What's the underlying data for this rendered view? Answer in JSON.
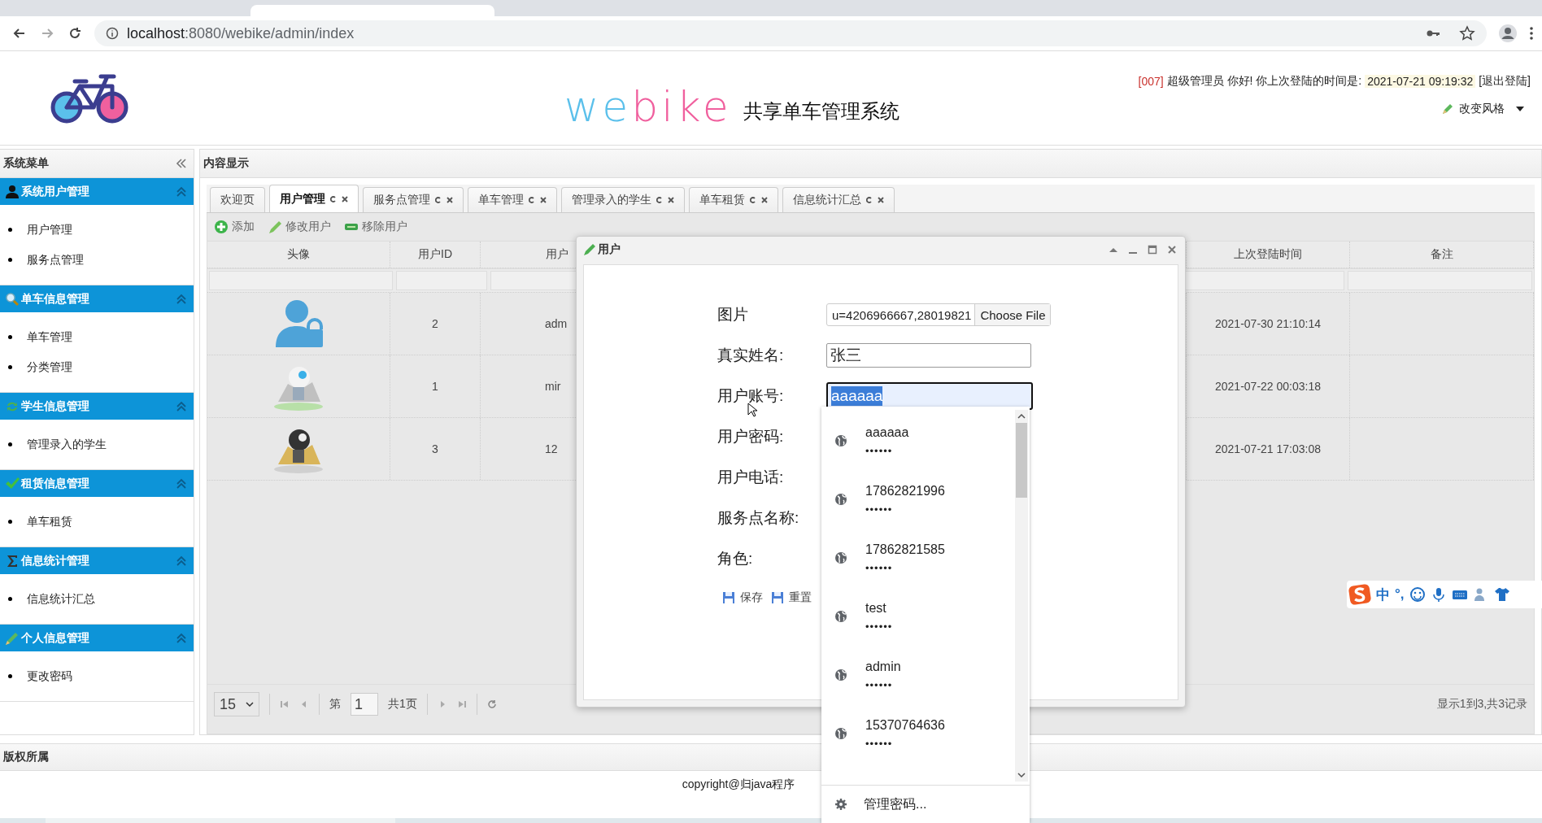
{
  "browser": {
    "host": "localhost",
    "path": ":8080/webike/admin/index"
  },
  "header": {
    "logo_parts": [
      {
        "text": "we",
        "color": "#5bc0eb"
      },
      {
        "text": "bike",
        "color": "#f0609e"
      }
    ],
    "subtitle": "共享单车管理系统",
    "user_code": "[007]",
    "greeting": "超级管理员 你好! 你上次登陆的时间是:",
    "last_login": "2021-07-21 09:19:32",
    "logout": "[退出登陆]",
    "style_menu": "改变风格"
  },
  "sidebar": {
    "title": "系统菜单",
    "sections": [
      {
        "title": "系统用户管理",
        "kind": "user",
        "expanded": true,
        "items": [
          "用户管理",
          "服务点管理"
        ]
      },
      {
        "title": "单车信息管理",
        "kind": "search",
        "expanded": true,
        "items": [
          "单车管理",
          "分类管理"
        ]
      },
      {
        "title": "学生信息管理",
        "kind": "refresh",
        "expanded": true,
        "items": [
          "管理录入的学生"
        ]
      },
      {
        "title": "租赁信息管理",
        "kind": "check",
        "expanded": true,
        "items": [
          "单车租赁"
        ]
      },
      {
        "title": "信息统计管理",
        "kind": "sigma",
        "expanded": true,
        "items": [
          "信息统计汇总"
        ]
      },
      {
        "title": "个人信息管理",
        "kind": "pencil",
        "expanded": true,
        "items": [
          "更改密码"
        ]
      }
    ]
  },
  "content": {
    "title": "内容显示",
    "tabs": [
      {
        "label": "欢迎页",
        "selected": false,
        "closable": false
      },
      {
        "label": "用户管理",
        "selected": true,
        "closable": true
      },
      {
        "label": "服务点管理",
        "selected": false,
        "closable": true
      },
      {
        "label": "单车管理",
        "selected": false,
        "closable": true
      },
      {
        "label": "管理录入的学生",
        "selected": false,
        "closable": true
      },
      {
        "label": "单车租赁",
        "selected": false,
        "closable": true
      },
      {
        "label": "信息统计汇总",
        "selected": false,
        "closable": true
      }
    ],
    "toolbar": [
      {
        "label": "添加",
        "kind": "add"
      },
      {
        "label": "修改用户",
        "kind": "edit"
      },
      {
        "label": "移除用户",
        "kind": "remove"
      }
    ],
    "columns": [
      "头像",
      "用户ID",
      "用户",
      "上次登陆时间",
      "备注"
    ],
    "rows": [
      {
        "kind": "icon",
        "id": "2",
        "account": "adm",
        "last_login": "2021-07-30 21:10:14"
      },
      {
        "kind": "picture",
        "id": "1",
        "account": "mir",
        "last_login": "2021-07-22 00:03:18"
      },
      {
        "kind": "picture",
        "id": "3",
        "account": "12",
        "last_login": "2021-07-21 17:03:08"
      }
    ],
    "pager": {
      "page_size": "15",
      "page_label": "第",
      "page": "1",
      "total_pages": "共1页",
      "summary": "显示1到3,共3记录"
    }
  },
  "dialog": {
    "title": "用户",
    "fields": [
      {
        "label": "图片",
        "kind": "file",
        "value": "u=4206966667,28019821",
        "button": "Choose File"
      },
      {
        "label": "真实姓名:",
        "kind": "text",
        "value": "张三"
      },
      {
        "label": "用户账号:",
        "kind": "selected",
        "value": "aaaaaa"
      },
      {
        "label": "用户密码:",
        "kind": "hidden"
      },
      {
        "label": "用户电话:",
        "kind": "hidden"
      },
      {
        "label": "服务点名称:",
        "kind": "hidden"
      },
      {
        "label": "角色:",
        "kind": "hidden"
      }
    ],
    "buttons": [
      "保存",
      "重置"
    ]
  },
  "autocomplete": {
    "entries": [
      {
        "name": "aaaaaa",
        "mask": "••••••"
      },
      {
        "name": "17862821996",
        "mask": "••••••"
      },
      {
        "name": "17862821585",
        "mask": "••••••"
      },
      {
        "name": "test",
        "mask": "••••••"
      },
      {
        "name": "admin",
        "mask": "••••••"
      },
      {
        "name": "15370764636",
        "mask": "••••••"
      }
    ],
    "manage": "管理密码..."
  },
  "footer": {
    "title": "版权所属",
    "copyright": "copyright@归java程序"
  },
  "ime": {
    "label": "中",
    "punct": "°,"
  }
}
